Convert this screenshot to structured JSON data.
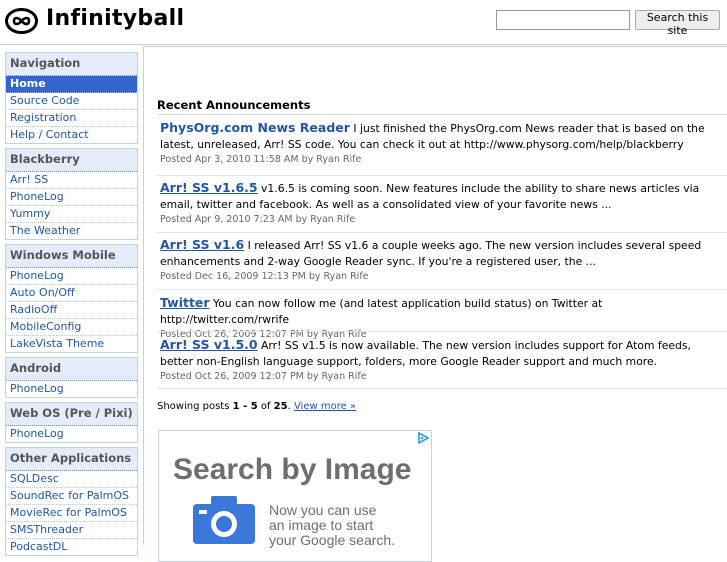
{
  "header": {
    "site_title": "Infinityball",
    "search_placeholder": "",
    "search_button": "Search this site"
  },
  "sidebar": {
    "sections": [
      {
        "title": "Navigation",
        "items": [
          "Home",
          "Source Code",
          "Registration",
          "Help / Contact"
        ],
        "active": 0
      },
      {
        "title": "Blackberry",
        "items": [
          "Arr! SS",
          "PhoneLog",
          "Yummy",
          "The Weather"
        ]
      },
      {
        "title": "Windows Mobile",
        "items": [
          "PhoneLog",
          "Auto On/Off",
          "RadioOff",
          "MobileConfig",
          "LakeVista Theme"
        ]
      },
      {
        "title": "Android",
        "items": [
          "PhoneLog"
        ]
      },
      {
        "title": "Web OS (Pre / Pixi)",
        "items": [
          "PhoneLog"
        ]
      },
      {
        "title": "Other Applications",
        "items": [
          "SQLDesc",
          "SoundRec for PalmOS",
          "MovieRec for PalmOS",
          "SMSThreader",
          "PodcastDL"
        ]
      }
    ]
  },
  "main": {
    "section_title": "Recent Announcements",
    "announcements": [
      {
        "title": "PhysOrg.com News Reader",
        "body": "I just finished the PhysOrg.com News reader that is based on the latest, unreleased, Arr! SS code.  You can check it out at http://www.physorg.com/help/blackberry",
        "meta": "Posted Apr 3, 2010 11:58 AM by Ryan Rife",
        "underline": false
      },
      {
        "title": "Arr! SS v1.6.5",
        "body": "v1.6.5 is coming soon.  New features include the ability to share news articles via email, twitter and facebook.  As well as a consolidated view of your favorite news ...",
        "meta": "Posted Apr 9, 2010 7:23 AM by Ryan Rife",
        "underline": true
      },
      {
        "title": "Arr! SS v1.6",
        "body": "I released Arr! SS v1.6 a couple weeks ago.  The new version includes several speed enhancements and 2-way Google Reader sync.  If you're a registered user, the ...",
        "meta": "Posted Dec 16, 2009 12:13 PM by Ryan Rife",
        "underline": true
      },
      {
        "title": "Twitter",
        "body": "You can now follow me (and latest application build status) on Twitter at http://twitter.com/rwrife",
        "meta": "Posted Oct 26, 2009 12:07 PM by Ryan Rife",
        "underline": true
      },
      {
        "title": "Arr! SS v1.5.0",
        "body": "Arr! SS v1.5 is now available.  The new version includes support for Atom feeds, better non-English language support, folders, more Google Reader support and much more.",
        "meta": "Posted Oct 26, 2009 12:07 PM by Ryan Rife",
        "underline": true
      }
    ],
    "posts_prefix": "Showing posts ",
    "posts_range": "1 - 5",
    "posts_of": " of ",
    "posts_total": "25",
    "posts_suffix": ". ",
    "view_more": "View more »"
  },
  "ad": {
    "title": "Search by Image",
    "line1": "Now you can use",
    "line2": "an image to start",
    "line3": "your Google search."
  },
  "colors": {
    "accent": "#3366cc",
    "link": "#2255aa",
    "nav_header_bg": "#e5ecf9",
    "ad_icon": "#3c78d8"
  }
}
